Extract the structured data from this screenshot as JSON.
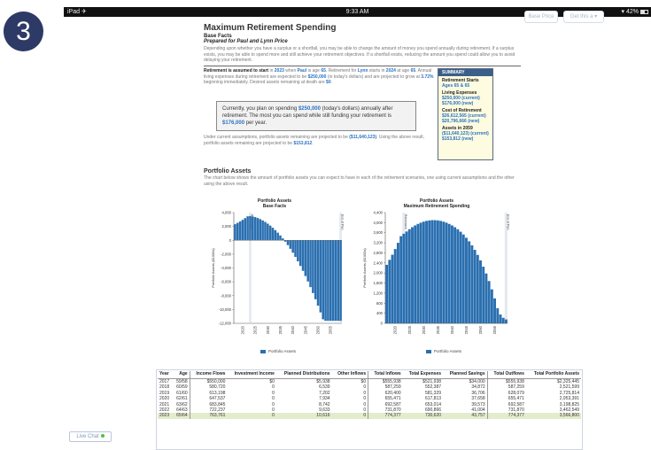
{
  "step_number": "3",
  "status_bar": {
    "carrier": "iPad ✈",
    "time": "9:33 AM",
    "battery": "▾ 42%"
  },
  "top_buttons": [
    "Base Price",
    "Get this a ▾"
  ],
  "header": {
    "title": "Maximum Retirement Spending",
    "subtitle": "Base Facts",
    "prepared_for": "Prepared for Paul and Lynn Price",
    "intro": "Depending upon whether you have a surplus or a shortfall, you may be able to change the amount of money you spend annually during retirement. If a surplus exists, you may be able to spend more and still achieve your retirement objectives. If a shortfall exists, reducing the amount you spend could allow you to avoid delaying your retirement."
  },
  "assumptions": {
    "lead": "Retirement is assumed to start",
    "t1": " in ",
    "year1": "2023",
    "t2": " when ",
    "person1": "Paul",
    "t3": " is age ",
    "age1": "65",
    "t4": ". Retirement for ",
    "person2": "Lynn",
    "t5": " starts in ",
    "year2": "2024",
    "t6": " at age ",
    "age2": "65",
    "t7": ". Annual living expenses during retirement are expected to be ",
    "expenses": "$250,000",
    "t8": " (in today's dollars) and are projected to grow at ",
    "growth": "3.72%",
    "t9": " beginning immediately. Desired assets remaining at death are ",
    "desired": "$0",
    "t10": "."
  },
  "callout": {
    "t1": "Currently, you plan on spending ",
    "current": "$250,000",
    "t2": " (today's dollars) annually after retirement. The most you can spend while still funding your retirement is ",
    "max": "$176,000",
    "t3": " per year."
  },
  "result": {
    "t1": "Under current assumptions, portfolio assets remaining are projected to be ",
    "current_remaining": "($11,640,123)",
    "t2": ". Using the above result, portfolio assets remaining are projected to be ",
    "new_remaining": "$153,812",
    "t3": "."
  },
  "summary": {
    "heading": "SUMMARY",
    "retirement_label": "Retirement Starts",
    "retirement_value": "Ages 65 & 65",
    "expenses_label": "Living Expenses",
    "expenses_current": "$250,000 (current)",
    "expenses_new": "$176,000 (new)",
    "cost_label": "Cost of Retirement",
    "cost_current": "$26,612,565 (current)",
    "cost_new": "$20,796,666 (new)",
    "assets_label": "Assets in 2059",
    "assets_current": "($11,640,123) (current)",
    "assets_new": "$153,812 (new)"
  },
  "portfolio_assets": {
    "title": "Portfolio Assets",
    "description": "The chart below shows the amount of portfolio assets you can expect to have in each of the retirement scenarios, one using current assumptions and the other using the above result."
  },
  "chart_data": [
    {
      "type": "bar",
      "title": "Portfolio Assets",
      "subtitle": "Base Facts",
      "ylabel": "Portfolio Assets ($1000s)",
      "ylim": [
        -12000,
        4000
      ],
      "yticks": [
        "4,000",
        "2,000",
        "0",
        "-2,000",
        "-4,000",
        "-6,000",
        "-8,000",
        "-10,000",
        "-12,000"
      ],
      "xticks": [
        "2020",
        "2025",
        "2030",
        "2035",
        "2040",
        "2045",
        "2050",
        "2055"
      ],
      "marker_labels": [
        "Retirement",
        "End of Plan"
      ],
      "legend": "Portfolio Assets",
      "color": "#2a6fb0",
      "x": [
        2017,
        2018,
        2019,
        2020,
        2021,
        2022,
        2023,
        2024,
        2025,
        2026,
        2027,
        2028,
        2029,
        2030,
        2031,
        2032,
        2033,
        2034,
        2035,
        2036,
        2037,
        2038,
        2039,
        2040,
        2041,
        2042,
        2043,
        2044,
        2045,
        2046,
        2047,
        2048,
        2049,
        2050,
        2051,
        2052,
        2053,
        2054,
        2055,
        2056,
        2057,
        2058,
        2059
      ],
      "values": [
        2325,
        2522,
        2726,
        2953,
        3199,
        3463,
        3500,
        3450,
        3350,
        3220,
        3060,
        2870,
        2650,
        2400,
        2120,
        1810,
        1470,
        1100,
        700,
        270,
        -200,
        -700,
        -1230,
        -1800,
        -2400,
        -3040,
        -3710,
        -4420,
        -5170,
        -5950,
        -6770,
        -7630,
        -8520,
        -9450,
        -10420,
        -11420,
        -11640,
        -11640,
        -11640,
        -11640,
        -11640,
        -11640,
        -11640
      ]
    },
    {
      "type": "bar",
      "title": "Portfolio Assets",
      "subtitle": "Maximum Retirement Spending",
      "ylabel": "Portfolio Assets ($1000s)",
      "ylim": [
        0,
        4400
      ],
      "yticks": [
        "4,400",
        "4,000",
        "3,600",
        "3,200",
        "2,800",
        "2,400",
        "2,000",
        "1,600",
        "1,200",
        "800",
        "400",
        "0"
      ],
      "xticks": [
        "2020",
        "2025",
        "2030",
        "2035",
        "2040",
        "2045",
        "2050",
        "2055"
      ],
      "marker_labels": [
        "Retirement",
        "End of Plan"
      ],
      "legend": "Portfolio Assets",
      "color": "#2a6fb0",
      "x": [
        2017,
        2018,
        2019,
        2020,
        2021,
        2022,
        2023,
        2024,
        2025,
        2026,
        2027,
        2028,
        2029,
        2030,
        2031,
        2032,
        2033,
        2034,
        2035,
        2036,
        2037,
        2038,
        2039,
        2040,
        2041,
        2042,
        2043,
        2044,
        2045,
        2046,
        2047,
        2048,
        2049,
        2050,
        2051,
        2052,
        2053,
        2054,
        2055,
        2056,
        2057,
        2058,
        2059
      ],
      "values": [
        2325,
        2522,
        2726,
        2953,
        3199,
        3463,
        3560,
        3650,
        3740,
        3820,
        3890,
        3950,
        4000,
        4040,
        4070,
        4090,
        4100,
        4100,
        4090,
        4070,
        4040,
        4000,
        3950,
        3890,
        3820,
        3740,
        3640,
        3530,
        3400,
        3260,
        3100,
        2920,
        2720,
        2500,
        2250,
        1980,
        1680,
        1350,
        990,
        600,
        350,
        220,
        154
      ]
    }
  ],
  "table": {
    "headers": [
      "Year",
      "Age",
      "Income Flows",
      "Investment Income",
      "Planned Distributions",
      "Other Inflows",
      "Total Inflows",
      "Total Expenses",
      "Planned Savings",
      "Total Outflows",
      "Total Portfolio Assets"
    ],
    "rows": [
      [
        "2017",
        "59/58",
        "$550,000",
        "$0",
        "$5,938",
        "$0",
        "$555,938",
        "$521,938",
        "$34,000",
        "$555,938",
        "$2,325,445"
      ],
      [
        "2018",
        "60/59",
        "580,720",
        "0",
        "6,539",
        "0",
        "587,259",
        "552,387",
        "34,872",
        "587,259",
        "2,521,599"
      ],
      [
        "2019",
        "61/60",
        "613,198",
        "0",
        "7,202",
        "0",
        "620,400",
        "581,329",
        "36,706",
        "628,079",
        "2,725,814"
      ],
      [
        "2020",
        "62/61",
        "647,537",
        "0",
        "7,934",
        "0",
        "655,471",
        "617,813",
        "37,658",
        "655,471",
        "2,953,391"
      ],
      [
        "2021",
        "63/62",
        "683,845",
        "0",
        "8,742",
        "0",
        "692,587",
        "653,014",
        "39,573",
        "692,587",
        "3,198,825"
      ],
      [
        "2022",
        "64/63",
        "722,237",
        "0",
        "9,633",
        "0",
        "731,870",
        "690,866",
        "41,004",
        "731,870",
        "3,462,549"
      ],
      [
        "2023",
        "65/64",
        "763,761",
        "0",
        "10,616",
        "0",
        "774,377",
        "730,620",
        "43,757",
        "774,377",
        "3,566,800"
      ]
    ]
  },
  "live_chat": "Live Chat"
}
